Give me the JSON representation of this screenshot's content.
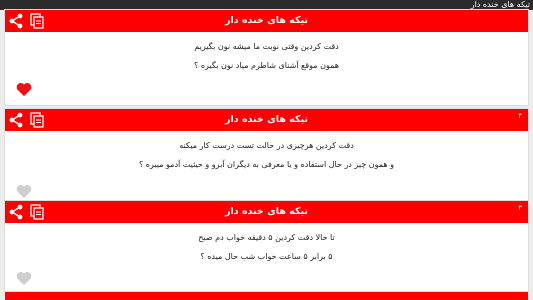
{
  "window": {
    "title": "تیکه های خنده دار"
  },
  "colors": {
    "header_red": "#ff0000",
    "heart_liked": "#ee1111",
    "heart_unliked": "#cfcfcf"
  },
  "cards": [
    {
      "number": "",
      "title": "تیکه های خنده دار",
      "lines": [
        "دقت کردین وقتی نوبت ما میشه نون بگیریم",
        "همون موقع آشنای شاطرم میاد نون بگیره ؟"
      ],
      "liked": true,
      "icons": [
        "share-icon",
        "copy-icon",
        "heart-icon"
      ]
    },
    {
      "number": "۴",
      "title": "تیکه های خنده دار",
      "lines": [
        "دقت کردین هرچیزی در حالت تست درست کار میکنه",
        "و همون چیز در حال استفاده و یا معرفی به دیگران آبرو و حیثیت آدمو میبره ؟"
      ],
      "liked": false,
      "icons": [
        "share-icon",
        "copy-icon",
        "heart-icon"
      ]
    },
    {
      "number": "۳",
      "title": "تیکه های خنده دار",
      "lines": [
        "تا حالا دقت کردین ۵ دقیقه خواب دم صبح",
        "۵ برابر ۵ ساعت خواب شب حال میده ؟"
      ],
      "liked": false,
      "icons": [
        "share-icon",
        "copy-icon",
        "heart-icon"
      ]
    }
  ]
}
